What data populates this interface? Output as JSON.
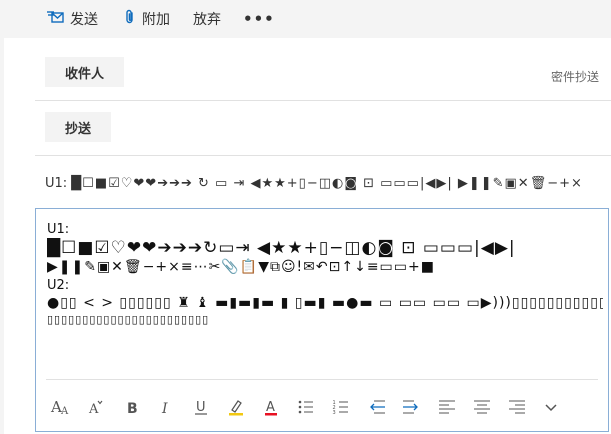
{
  "commandbar": {
    "send_label": "发送",
    "attach_label": "附加",
    "discard_label": "放弃",
    "more_label": "•••"
  },
  "recipients": {
    "to_label": "收件人",
    "cc_label": "抄送",
    "bcc_label": "密件抄送"
  },
  "subject": {
    "prefix": "U1:",
    "symbols": "█☐■☑♡❤❤➔➔➔ ↻ ▭ ⇥ ◀★★+▯−◫◐◙ ⊡ ▭▭▭|◀▶| ▶❚❚✎▣✕🗑−+×"
  },
  "body": {
    "u1_label": "U1:",
    "u1_line1": "█☐■☑♡❤❤➔➔➔↻▭⇥ ◀★★+▯−◫◐◙ ⊡ ▭▭▭|◀▶|",
    "u1_line2": "▶❚❚✎▣✕🗑−+×≡⋯✂📎📋▼⧉☺!✉↶⊡↑↓≡▭▭+■",
    "u2_label": "U2:",
    "u2_line1": "●▯▯ < > ▯▯▯▯▯▯ ♜ ♝ ▬▮▬▮▬ ▮ ▯▬▮ ▬●▬ ▭ ▭▭ ▭▭ ▭▶)))▯▯▯▯▯▯▯▯▯▯▯▯▯▯▯▯▯▯▯▯▯▯▯▯▯▯▯▯▯▯▯▯▯▯",
    "u2_line2": "▯▯▯▯▯▯▯▯▯▯▯▯▯▯▯▯▯▯▯▯▯▯▯"
  },
  "colors": {
    "accent": "#0f6cbd",
    "highlight": "#f2c811",
    "font_color": "#e81123",
    "body_border": "#8aaed6"
  },
  "format_toolbar": [
    "font-size-icon",
    "shrink-font-icon",
    "bold-icon",
    "italic-icon",
    "underline-icon",
    "highlight-icon",
    "font-color-icon",
    "bullets-icon",
    "numbering-icon",
    "decrease-indent-icon",
    "increase-indent-icon",
    "align-left-icon",
    "align-center-icon",
    "align-right-icon",
    "more-options-chevron-icon"
  ]
}
